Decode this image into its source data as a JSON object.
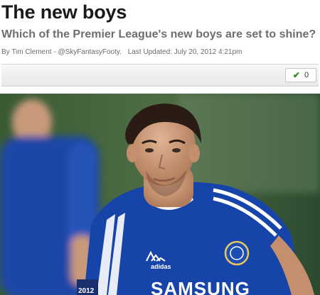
{
  "article": {
    "title": "The new boys",
    "subtitle": "Which of the Premier League's new boys are set to shine?",
    "byline": {
      "author": "By Tim Clement - @SkyFantasyFooty.",
      "updated": "Last Updated: July 20, 2012 4:21pm"
    }
  },
  "toolbar": {
    "like_icon": "check-icon",
    "like_count": "0",
    "accent": "#2e8a1e"
  },
  "hero_image": {
    "kit_color": "#1744a8",
    "sponsor_text": "SAMSUNG",
    "kit_brand_text": "adidas",
    "badge_year_text": "2012"
  }
}
